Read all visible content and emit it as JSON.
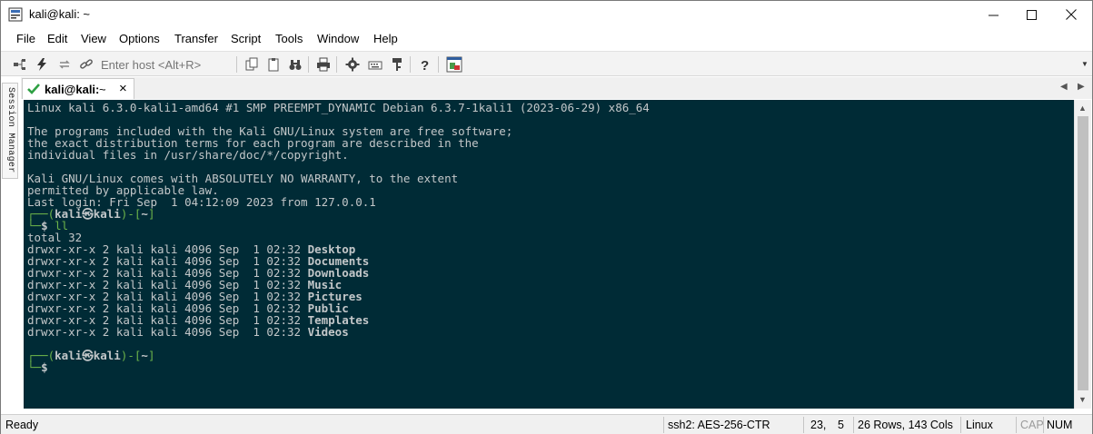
{
  "window": {
    "title": "kali@kali: ~",
    "minimize": "—",
    "maximize": "☐",
    "close": "✕"
  },
  "menu": [
    "File",
    "Edit",
    "View",
    "Options",
    "Transfer",
    "Script",
    "Tools",
    "Window",
    "Help"
  ],
  "toolbar": {
    "host_placeholder": "Enter host <Alt+R>"
  },
  "tab": {
    "label_bold": "kali@kali:",
    "label_tail": "~",
    "close": "×"
  },
  "session_manager_label": "Session Manager",
  "terminal": {
    "lines": [
      "Linux kali 6.3.0-kali1-amd64 #1 SMP PREEMPT_DYNAMIC Debian 6.3.7-1kali1 (2023-06-29) x86_64",
      "",
      "The programs included with the Kali GNU/Linux system are free software;",
      "the exact distribution terms for each program are described in the",
      "individual files in /usr/share/doc/*/copyright.",
      "",
      "Kali GNU/Linux comes with ABSOLUTELY NO WARRANTY, to the extent",
      "permitted by applicable law.",
      "Last login: Fri Sep  1 04:12:09 2023 from 127.0.0.1"
    ],
    "prompt_user": "kali",
    "prompt_host": "kali",
    "prompt_path": "~",
    "command": "ll",
    "total": "total 32",
    "dir_prefix": "drwxr-xr-x 2 kali kali 4096 Sep  1 02:32 ",
    "dirs": [
      "Desktop",
      "Documents",
      "Downloads",
      "Music",
      "Pictures",
      "Public",
      "Templates",
      "Videos"
    ]
  },
  "status": {
    "ready": "Ready",
    "cipher": "ssh2: AES-256-CTR",
    "row": "23,",
    "col": "5",
    "size": "26 Rows, 143 Cols",
    "os": "Linux",
    "cap": "CAP",
    "num": "NUM"
  }
}
